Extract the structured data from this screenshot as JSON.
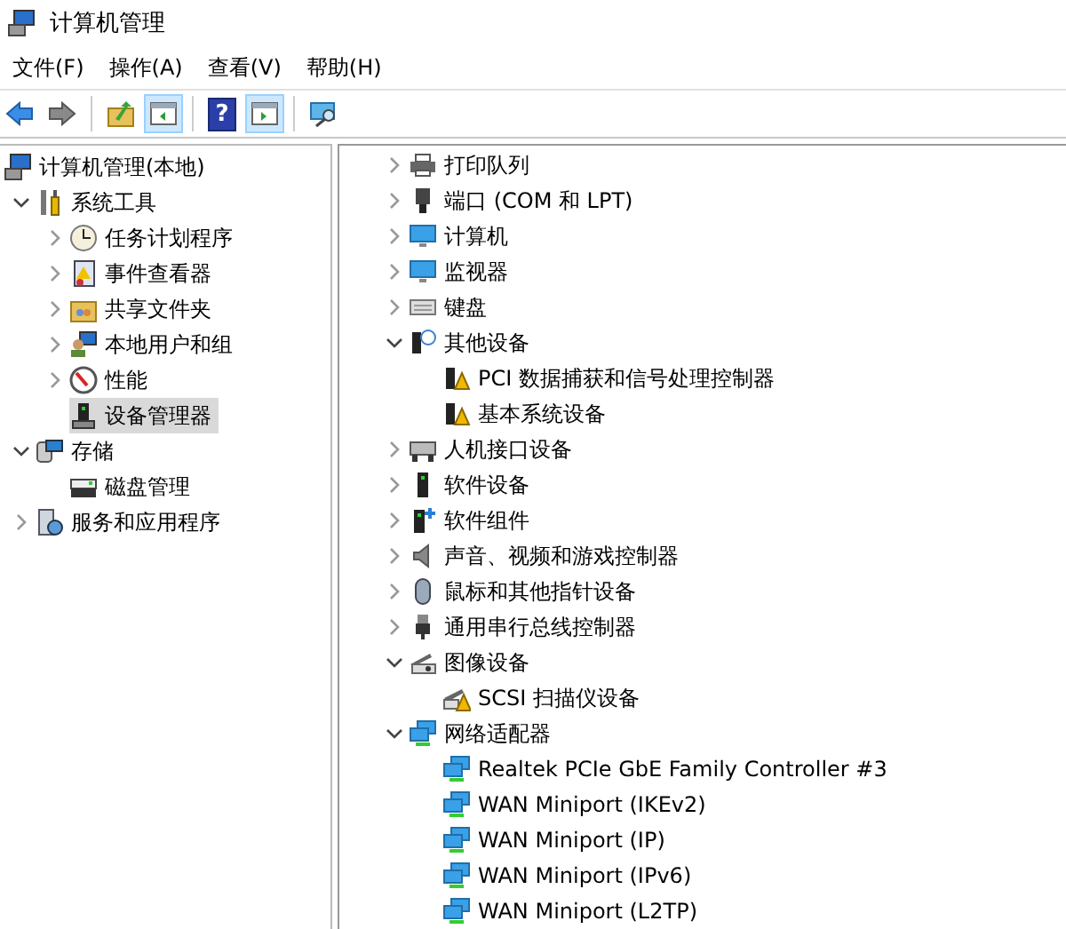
{
  "window": {
    "title": "计算机管理"
  },
  "menu": [
    "文件(F)",
    "操作(A)",
    "查看(V)",
    "帮助(H)"
  ],
  "toolbar": [
    {
      "kind": "back",
      "pressed": false
    },
    {
      "kind": "forward",
      "pressed": false
    },
    {
      "kind": "separator"
    },
    {
      "kind": "up",
      "pressed": false
    },
    {
      "kind": "tree-pane",
      "pressed": true
    },
    {
      "kind": "separator"
    },
    {
      "kind": "help",
      "label": "?",
      "pressed": false
    },
    {
      "kind": "action-pane",
      "pressed": true
    },
    {
      "kind": "separator"
    },
    {
      "kind": "console",
      "pressed": false
    }
  ],
  "navigation": {
    "tree": [
      {
        "label": "计算机管理(本地)",
        "kind": "computer",
        "selected": false,
        "children": [
          {
            "label": "系统工具",
            "kind": "tools",
            "expanded": true,
            "selected": false,
            "children": [
              {
                "label": "任务计划程序",
                "kind": "clock",
                "expanded": false,
                "selected": false
              },
              {
                "label": "事件查看器",
                "kind": "log",
                "expanded": false,
                "selected": false
              },
              {
                "label": "共享文件夹",
                "kind": "folder",
                "expanded": false,
                "selected": false
              },
              {
                "label": "本地用户和组",
                "kind": "users",
                "expanded": false,
                "selected": false
              },
              {
                "label": "性能",
                "kind": "gauge",
                "expanded": false,
                "selected": false
              },
              {
                "label": "设备管理器",
                "kind": "device",
                "selected": true
              }
            ]
          },
          {
            "label": "存储",
            "kind": "storage",
            "expanded": true,
            "selected": false,
            "children": [
              {
                "label": "磁盘管理",
                "kind": "disk",
                "selected": false
              }
            ]
          },
          {
            "label": "服务和应用程序",
            "kind": "services",
            "expanded": false,
            "selected": false
          }
        ]
      }
    ]
  },
  "devices": {
    "tree": [
      {
        "label": "打印队列",
        "kind": "printer",
        "expanded": false
      },
      {
        "label": "端口 (COM 和 LPT)",
        "kind": "port",
        "expanded": false
      },
      {
        "label": "计算机",
        "kind": "monitor",
        "expanded": false
      },
      {
        "label": "监视器",
        "kind": "monitor",
        "expanded": false
      },
      {
        "label": "键盘",
        "kind": "keyboard",
        "expanded": false
      },
      {
        "label": "其他设备",
        "kind": "unknown",
        "expanded": true,
        "children": [
          {
            "label": "PCI 数据捕获和信号处理控制器",
            "kind": "warning"
          },
          {
            "label": "基本系统设备",
            "kind": "warning"
          }
        ]
      },
      {
        "label": "人机接口设备",
        "kind": "hid",
        "expanded": false
      },
      {
        "label": "软件设备",
        "kind": "chip",
        "expanded": false
      },
      {
        "label": "软件组件",
        "kind": "component",
        "expanded": false
      },
      {
        "label": "声音、视频和游戏控制器",
        "kind": "sound",
        "expanded": false
      },
      {
        "label": "鼠标和其他指针设备",
        "kind": "mouse",
        "expanded": false
      },
      {
        "label": "通用串行总线控制器",
        "kind": "usb",
        "expanded": false
      },
      {
        "label": "图像设备",
        "kind": "camera",
        "expanded": true,
        "children": [
          {
            "label": "SCSI 扫描仪设备",
            "kind": "camera-warning"
          }
        ]
      },
      {
        "label": "网络适配器",
        "kind": "network",
        "expanded": true,
        "children": [
          {
            "label": "Realtek PCIe GbE Family Controller #3",
            "kind": "network"
          },
          {
            "label": "WAN Miniport (IKEv2)",
            "kind": "network"
          },
          {
            "label": "WAN Miniport (IP)",
            "kind": "network"
          },
          {
            "label": "WAN Miniport (IPv6)",
            "kind": "network"
          },
          {
            "label": "WAN Miniport (L2TP)",
            "kind": "network"
          }
        ]
      }
    ]
  }
}
